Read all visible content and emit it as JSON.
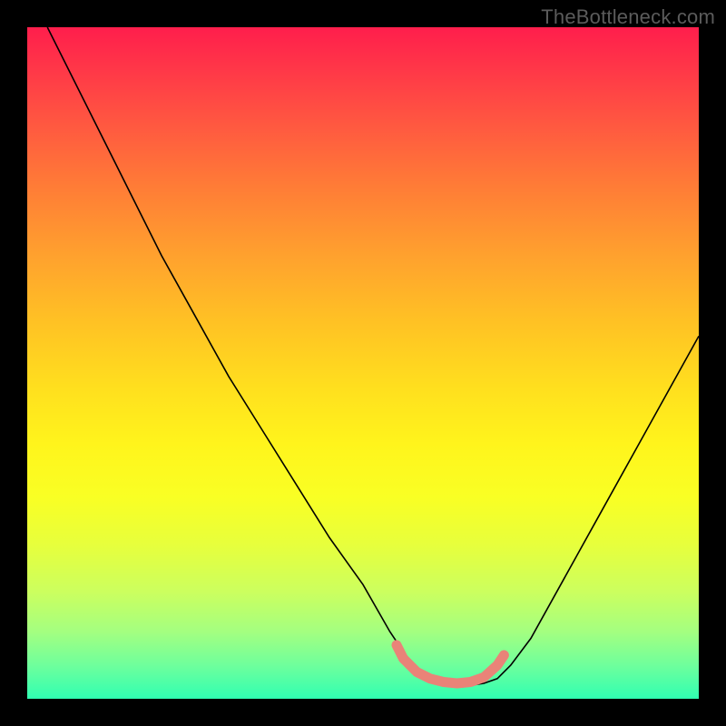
{
  "watermark": "TheBottleneck.com",
  "chart_data": {
    "type": "line",
    "title": "",
    "xlabel": "",
    "ylabel": "",
    "xlim": [
      0,
      100
    ],
    "ylim": [
      0,
      100
    ],
    "grid": false,
    "series": [
      {
        "name": "bottleneck-curve",
        "x": [
          3,
          10,
          15,
          20,
          25,
          30,
          35,
          40,
          45,
          50,
          54,
          56,
          58,
          60,
          62,
          64,
          66,
          68,
          70,
          72,
          75,
          80,
          85,
          90,
          95,
          100
        ],
        "y": [
          100,
          86,
          76,
          66,
          57,
          48,
          40,
          32,
          24,
          17,
          10,
          7,
          4.5,
          3,
          2.3,
          2.0,
          2.0,
          2.3,
          3,
          5,
          9,
          18,
          27,
          36,
          45,
          54
        ]
      }
    ],
    "highlight": {
      "name": "valley-highlight",
      "x": [
        55,
        56,
        58,
        60,
        62,
        64,
        66,
        68,
        70,
        71
      ],
      "y": [
        8,
        6,
        4,
        3,
        2.5,
        2.3,
        2.5,
        3.2,
        5,
        6.5
      ],
      "color": "#E98378"
    },
    "background": "heat-gradient-red-to-green"
  }
}
